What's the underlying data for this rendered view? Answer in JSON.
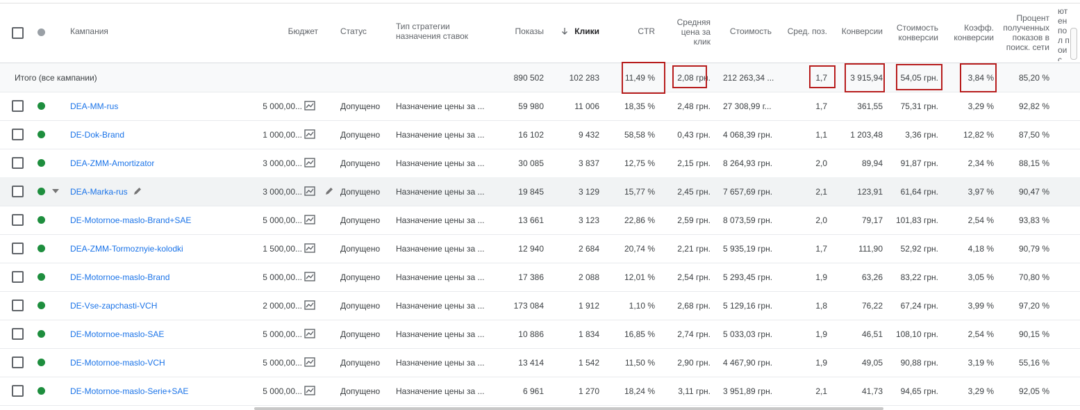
{
  "headers": {
    "campaign": "Кампания",
    "budget": "Бюджет",
    "status": "Статус",
    "strategy": "Тип стратегии назначения ставок",
    "impressions": "Показы",
    "clicks": "Клики",
    "ctr": "CTR",
    "avg_cpc": "Средняя цена за клик",
    "cost": "Стоимость",
    "avg_pos": "Сред. поз.",
    "conversions": "Конверсии",
    "cost_conv": "Стоимость конверсии",
    "conv_rate": "Коэфф. конверсии",
    "search_share": "Процент полученных показов в поиск. сети",
    "partial": "П ютен пол поис (р"
  },
  "total": {
    "label": "Итого (все кампании)",
    "impressions": "890 502",
    "clicks": "102 283",
    "ctr": "11,49 %",
    "avg_cpc": "2,08 грн.",
    "cost": "212 263,34 ...",
    "avg_pos": "1,7",
    "conversions": "3 915,94",
    "cost_conv": "54,05 грн.",
    "conv_rate": "3,84 %",
    "search_share": "85,20 %"
  },
  "rows": [
    {
      "name": "DEA-MM-rus",
      "budget": "5 000,00...",
      "status": "Допущено",
      "strategy": "Назначение цены за ...",
      "impressions": "59 980",
      "clicks": "11 006",
      "ctr": "18,35 %",
      "avg_cpc": "2,48 грн.",
      "cost": "27 308,99 г...",
      "avg_pos": "1,7",
      "conversions": "361,55",
      "cost_conv": "75,31 грн.",
      "conv_rate": "3,29 %",
      "search_share": "92,82 %"
    },
    {
      "name": "DE-Dok-Brand",
      "budget": "1 000,00...",
      "status": "Допущено",
      "strategy": "Назначение цены за ...",
      "impressions": "16 102",
      "clicks": "9 432",
      "ctr": "58,58 %",
      "avg_cpc": "0,43 грн.",
      "cost": "4 068,39 грн.",
      "avg_pos": "1,1",
      "conversions": "1 203,48",
      "cost_conv": "3,36 грн.",
      "conv_rate": "12,82 %",
      "search_share": "87,50 %"
    },
    {
      "name": "DEA-ZMM-Amortizator",
      "budget": "3 000,00...",
      "status": "Допущено",
      "strategy": "Назначение цены за ...",
      "impressions": "30 085",
      "clicks": "3 837",
      "ctr": "12,75 %",
      "avg_cpc": "2,15 грн.",
      "cost": "8 264,93 грн.",
      "avg_pos": "2,0",
      "conversions": "89,94",
      "cost_conv": "91,87 грн.",
      "conv_rate": "2,34 %",
      "search_share": "88,15 %"
    },
    {
      "name": "DEA-Marka-rus",
      "budget": "3 000,00...",
      "status": "Допущено",
      "strategy": "Назначение цены за ...",
      "impressions": "19 845",
      "clicks": "3 129",
      "ctr": "15,77 %",
      "avg_cpc": "2,45 грн.",
      "cost": "7 657,69 грн.",
      "avg_pos": "2,1",
      "conversions": "123,91",
      "cost_conv": "61,64 грн.",
      "conv_rate": "3,97 %",
      "search_share": "90,47 %"
    },
    {
      "name": "DE-Motornoe-maslo-Brand+SAE",
      "budget": "5 000,00...",
      "status": "Допущено",
      "strategy": "Назначение цены за ...",
      "impressions": "13 661",
      "clicks": "3 123",
      "ctr": "22,86 %",
      "avg_cpc": "2,59 грн.",
      "cost": "8 073,59 грн.",
      "avg_pos": "2,0",
      "conversions": "79,17",
      "cost_conv": "101,83 грн.",
      "conv_rate": "2,54 %",
      "search_share": "93,83 %"
    },
    {
      "name": "DEA-ZMM-Tormoznyie-kolodki",
      "budget": "1 500,00...",
      "status": "Допущено",
      "strategy": "Назначение цены за ...",
      "impressions": "12 940",
      "clicks": "2 684",
      "ctr": "20,74 %",
      "avg_cpc": "2,21 грн.",
      "cost": "5 935,19 грн.",
      "avg_pos": "1,7",
      "conversions": "111,90",
      "cost_conv": "52,92 грн.",
      "conv_rate": "4,18 %",
      "search_share": "90,79 %"
    },
    {
      "name": "DE-Motornoe-maslo-Brand",
      "budget": "5 000,00...",
      "status": "Допущено",
      "strategy": "Назначение цены за ...",
      "impressions": "17 386",
      "clicks": "2 088",
      "ctr": "12,01 %",
      "avg_cpc": "2,54 грн.",
      "cost": "5 293,45 грн.",
      "avg_pos": "1,9",
      "conversions": "63,26",
      "cost_conv": "83,22 грн.",
      "conv_rate": "3,05 %",
      "search_share": "70,80 %"
    },
    {
      "name": "DE-Vse-zapchasti-VCH",
      "budget": "2 000,00...",
      "status": "Допущено",
      "strategy": "Назначение цены за ...",
      "impressions": "173 084",
      "clicks": "1 912",
      "ctr": "1,10 %",
      "avg_cpc": "2,68 грн.",
      "cost": "5 129,16 грн.",
      "avg_pos": "1,8",
      "conversions": "76,22",
      "cost_conv": "67,24 грн.",
      "conv_rate": "3,99 %",
      "search_share": "97,20 %"
    },
    {
      "name": "DE-Motornoe-maslo-SAE",
      "budget": "5 000,00...",
      "status": "Допущено",
      "strategy": "Назначение цены за ...",
      "impressions": "10 886",
      "clicks": "1 834",
      "ctr": "16,85 %",
      "avg_cpc": "2,74 грн.",
      "cost": "5 033,03 грн.",
      "avg_pos": "1,9",
      "conversions": "46,51",
      "cost_conv": "108,10 грн.",
      "conv_rate": "2,54 %",
      "search_share": "90,15 %"
    },
    {
      "name": "DE-Motornoe-maslo-VCH",
      "budget": "5 000,00...",
      "status": "Допущено",
      "strategy": "Назначение цены за ...",
      "impressions": "13 414",
      "clicks": "1 542",
      "ctr": "11,50 %",
      "avg_cpc": "2,90 грн.",
      "cost": "4 467,90 грн.",
      "avg_pos": "1,9",
      "conversions": "49,05",
      "cost_conv": "90,88 грн.",
      "conv_rate": "3,19 %",
      "search_share": "55,16 %"
    },
    {
      "name": "DE-Motornoe-maslo-Serie+SAE",
      "budget": "5 000,00...",
      "status": "Допущено",
      "strategy": "Назначение цены за ...",
      "impressions": "6 961",
      "clicks": "1 270",
      "ctr": "18,24 %",
      "avg_cpc": "3,11 грн.",
      "cost": "3 951,89 грн.",
      "avg_pos": "2,1",
      "conversions": "41,73",
      "cost_conv": "94,65 грн.",
      "conv_rate": "3,29 %",
      "search_share": "92,05 %"
    }
  ],
  "colors": {
    "enabled_dot": "#1e8e3e",
    "header_dot": "#9aa0a6",
    "link": "#1a73e8",
    "highlight_box": "#b71c1c"
  },
  "icons": {
    "sort": "arrow-down-icon",
    "budget": "chart-icon",
    "edit": "pencil-icon",
    "expand": "caret-down-icon"
  },
  "sort_column": "clicks",
  "hovered_row_index": 3
}
